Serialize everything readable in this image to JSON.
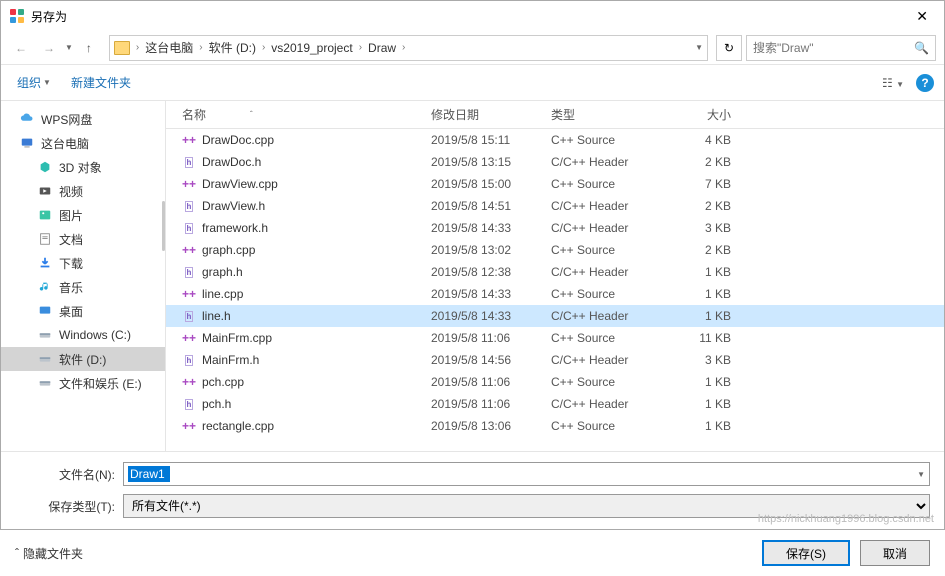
{
  "window": {
    "title": "另存为"
  },
  "nav": {
    "breadcrumb": [
      "这台电脑",
      "软件 (D:)",
      "vs2019_project",
      "Draw"
    ],
    "search_placeholder": "搜索\"Draw\""
  },
  "toolbar": {
    "organize": "组织",
    "newfolder": "新建文件夹"
  },
  "sidebar": {
    "items": [
      {
        "label": "WPS网盘",
        "icon": "cloud",
        "indent": 0
      },
      {
        "label": "这台电脑",
        "icon": "pc",
        "indent": 0
      },
      {
        "label": "3D 对象",
        "icon": "3d",
        "indent": 1
      },
      {
        "label": "视频",
        "icon": "video",
        "indent": 1
      },
      {
        "label": "图片",
        "icon": "image",
        "indent": 1
      },
      {
        "label": "文档",
        "icon": "doc",
        "indent": 1
      },
      {
        "label": "下载",
        "icon": "download",
        "indent": 1
      },
      {
        "label": "音乐",
        "icon": "music",
        "indent": 1
      },
      {
        "label": "桌面",
        "icon": "desktop",
        "indent": 1
      },
      {
        "label": "Windows (C:)",
        "icon": "drive",
        "indent": 1
      },
      {
        "label": "软件 (D:)",
        "icon": "drive",
        "indent": 1,
        "selected": true
      },
      {
        "label": "文件和娱乐 (E:)",
        "icon": "drive",
        "indent": 1
      }
    ]
  },
  "columns": {
    "name": "名称",
    "date": "修改日期",
    "type": "类型",
    "size": "大小"
  },
  "files": [
    {
      "name": "DrawDoc.cpp",
      "date": "2019/5/8 15:11",
      "type": "C++ Source",
      "size": "4 KB",
      "icon": "cpp"
    },
    {
      "name": "DrawDoc.h",
      "date": "2019/5/8 13:15",
      "type": "C/C++ Header",
      "size": "2 KB",
      "icon": "h"
    },
    {
      "name": "DrawView.cpp",
      "date": "2019/5/8 15:00",
      "type": "C++ Source",
      "size": "7 KB",
      "icon": "cpp"
    },
    {
      "name": "DrawView.h",
      "date": "2019/5/8 14:51",
      "type": "C/C++ Header",
      "size": "2 KB",
      "icon": "h"
    },
    {
      "name": "framework.h",
      "date": "2019/5/8 14:33",
      "type": "C/C++ Header",
      "size": "3 KB",
      "icon": "h"
    },
    {
      "name": "graph.cpp",
      "date": "2019/5/8 13:02",
      "type": "C++ Source",
      "size": "2 KB",
      "icon": "cpp"
    },
    {
      "name": "graph.h",
      "date": "2019/5/8 12:38",
      "type": "C/C++ Header",
      "size": "1 KB",
      "icon": "h"
    },
    {
      "name": "line.cpp",
      "date": "2019/5/8 14:33",
      "type": "C++ Source",
      "size": "1 KB",
      "icon": "cpp"
    },
    {
      "name": "line.h",
      "date": "2019/5/8 14:33",
      "type": "C/C++ Header",
      "size": "1 KB",
      "icon": "h",
      "selected": true
    },
    {
      "name": "MainFrm.cpp",
      "date": "2019/5/8 11:06",
      "type": "C++ Source",
      "size": "11 KB",
      "icon": "cpp"
    },
    {
      "name": "MainFrm.h",
      "date": "2019/5/8 14:56",
      "type": "C/C++ Header",
      "size": "3 KB",
      "icon": "h"
    },
    {
      "name": "pch.cpp",
      "date": "2019/5/8 11:06",
      "type": "C++ Source",
      "size": "1 KB",
      "icon": "cpp"
    },
    {
      "name": "pch.h",
      "date": "2019/5/8 11:06",
      "type": "C/C++ Header",
      "size": "1 KB",
      "icon": "h"
    },
    {
      "name": "rectangle.cpp",
      "date": "2019/5/8 13:06",
      "type": "C++ Source",
      "size": "1 KB",
      "icon": "cpp"
    }
  ],
  "form": {
    "filename_label": "文件名(N):",
    "filename_value": "Draw1",
    "filetype_label": "保存类型(T):",
    "filetype_value": "所有文件(*.*)"
  },
  "footer": {
    "hide_folders": "隐藏文件夹",
    "save": "保存(S)",
    "cancel": "取消"
  },
  "watermark": "https://nickhuang1996.blog.csdn.net"
}
